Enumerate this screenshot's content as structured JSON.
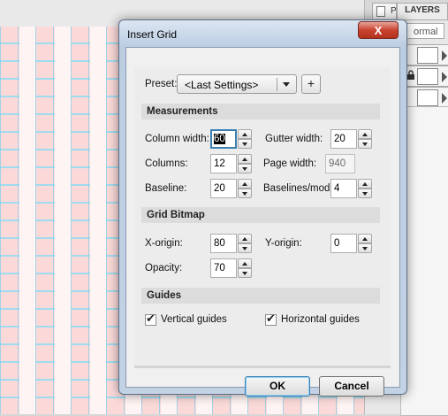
{
  "layers_panel": {
    "page_tab_label": "P",
    "layers_tab_label": "LAYERS",
    "blend_mode": "ormal"
  },
  "dialog": {
    "title": "Insert Grid",
    "close_symbol": "X",
    "preset": {
      "label": "Preset:",
      "value": "<Last Settings>",
      "add_symbol": "+"
    },
    "measurements": {
      "header": "Measurements",
      "column_width_label": "Column width:",
      "column_width_value": "60",
      "gutter_width_label": "Gutter width:",
      "gutter_width_value": "20",
      "columns_label": "Columns:",
      "columns_value": "12",
      "page_width_label": "Page width:",
      "page_width_value": "940",
      "baseline_label": "Baseline:",
      "baseline_value": "20",
      "baselines_mod_label": "Baselines/mod:",
      "baselines_mod_value": "4"
    },
    "grid_bitmap": {
      "header": "Grid Bitmap",
      "x_origin_label": "X-origin:",
      "x_origin_value": "80",
      "y_origin_label": "Y-origin:",
      "y_origin_value": "0",
      "opacity_label": "Opacity:",
      "opacity_value": "70"
    },
    "guides": {
      "header": "Guides",
      "vertical_label": "Vertical guides",
      "vertical_checked": true,
      "horizontal_label": "Horizontal guides",
      "horizontal_checked": true
    },
    "ok_label": "OK",
    "cancel_label": "Cancel"
  },
  "colors": {
    "accent": "#3c7fb1",
    "grid_column": "#fbd9d9",
    "grid_line": "#7fcfe8",
    "close_button": "#c9432f"
  }
}
